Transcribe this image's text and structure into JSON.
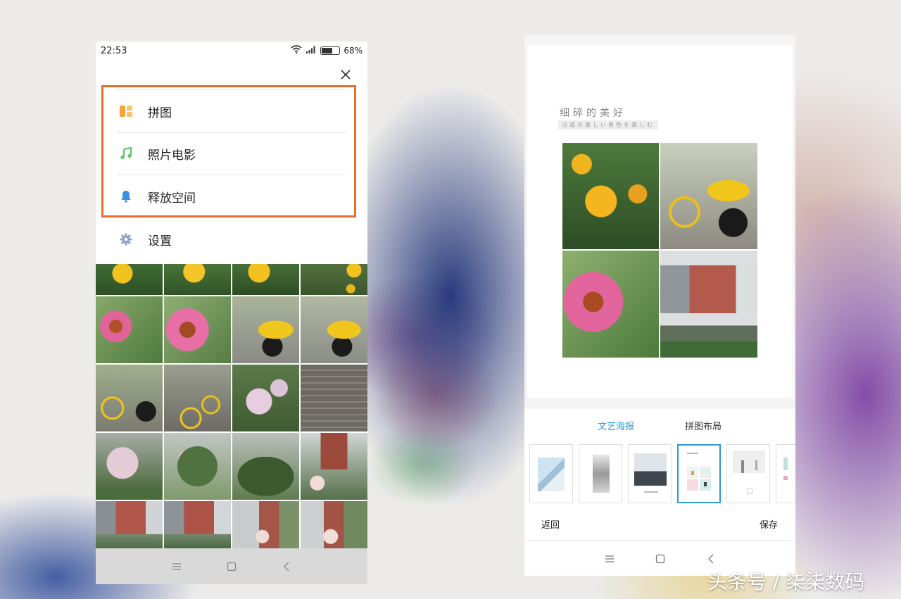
{
  "left_phone": {
    "status": {
      "time": "22:53",
      "battery": "68%",
      "battery_level": 0.68
    },
    "menu": {
      "items": [
        {
          "label": "拼图",
          "icon": "collage-icon"
        },
        {
          "label": "照片电影",
          "icon": "music-note-icon"
        },
        {
          "label": "释放空间",
          "icon": "bell-icon"
        },
        {
          "label": "设置",
          "icon": "gear-icon"
        }
      ]
    },
    "highlight_color": "#e56f2c"
  },
  "right_phone": {
    "poster": {
      "title": "细碎的美好",
      "subtitle": "沿道の美しい景色を楽しむ"
    },
    "tabs": [
      {
        "label": "文艺海报",
        "active": true
      },
      {
        "label": "拼图布局",
        "active": false
      }
    ],
    "actions": {
      "back": "返回",
      "save": "保存"
    },
    "accent_color": "#2d9ad6"
  },
  "watermark": "头条号 / 柒柒数码"
}
